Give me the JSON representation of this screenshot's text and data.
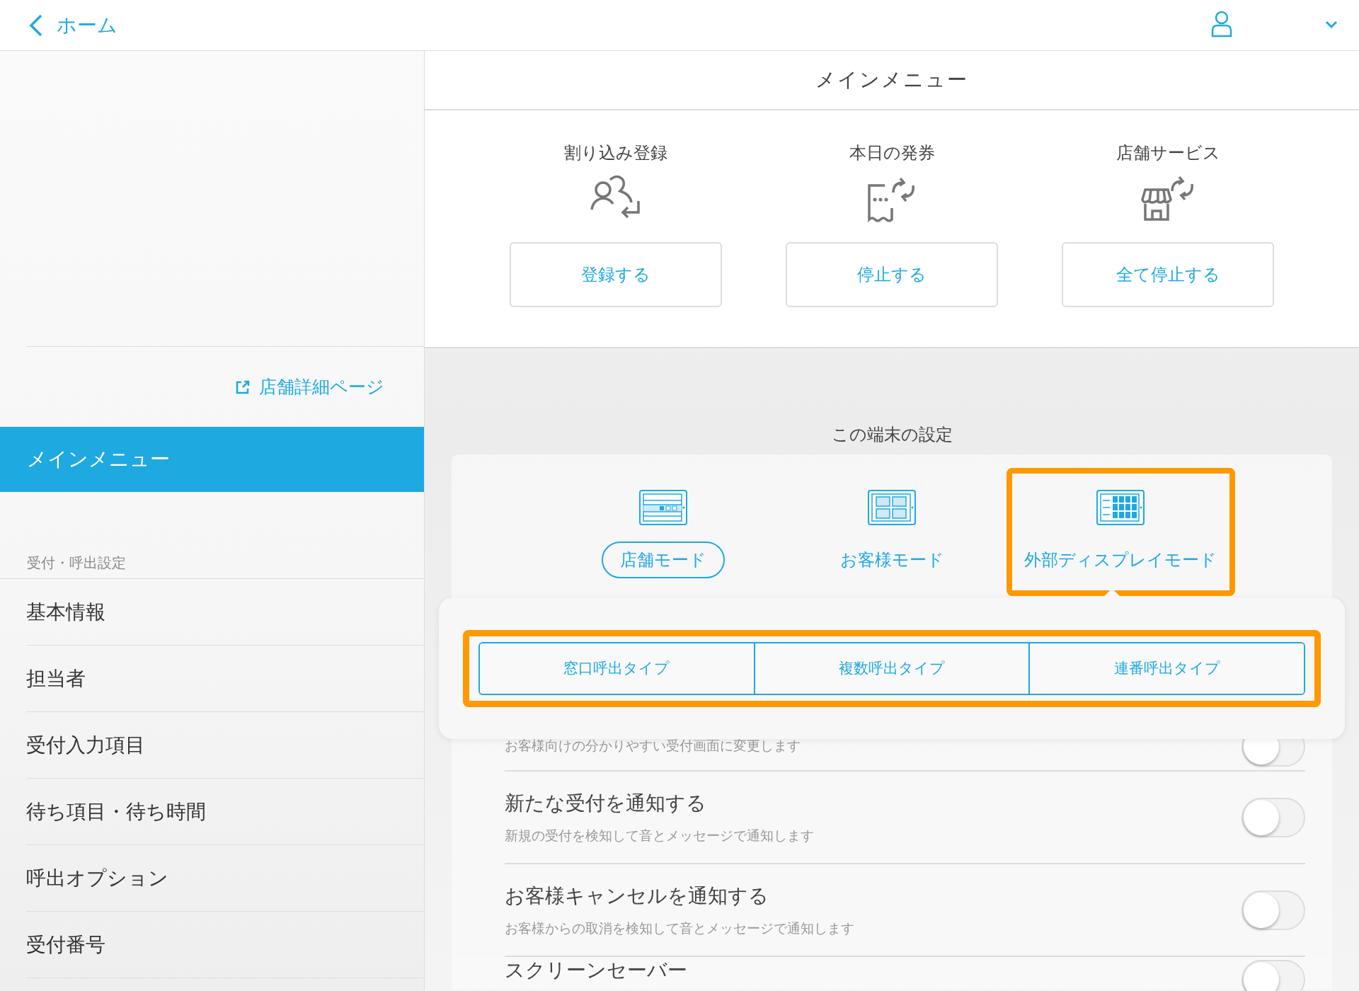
{
  "header": {
    "back_label": "ホーム"
  },
  "sidebar": {
    "link": "店舗詳細ページ",
    "items": [
      {
        "label": "メインメニュー",
        "selected": true
      }
    ],
    "section": {
      "title": "受付・呼出設定",
      "items": [
        {
          "label": "基本情報",
          "selected": false
        },
        {
          "label": "担当者",
          "selected": false
        },
        {
          "label": "受付入力項目",
          "selected": false
        },
        {
          "label": "待ち項目・待ち時間",
          "selected": false
        },
        {
          "label": "呼出オプション",
          "selected": false
        },
        {
          "label": "受付番号",
          "selected": false
        }
      ]
    }
  },
  "main": {
    "title": "メインメニュー",
    "actions": [
      {
        "title": "割り込み登録",
        "button": "登録する"
      },
      {
        "title": "本日の発券",
        "button": "停止する"
      },
      {
        "title": "店舗サービス",
        "button": "全て停止する"
      }
    ],
    "device_settings": {
      "title": "この端末の設定",
      "modes": [
        {
          "label": "店舗モード",
          "selected": true,
          "highlighted": false
        },
        {
          "label": "お客様モード",
          "selected": false,
          "highlighted": false
        },
        {
          "label": "外部ディスプレイモード",
          "selected": false,
          "highlighted": true
        }
      ],
      "call_types": {
        "highlighted": true,
        "options": [
          {
            "label": "窓口呼出タイプ"
          },
          {
            "label": "複数呼出タイプ"
          },
          {
            "label": "連番呼出タイプ"
          }
        ]
      },
      "settings": [
        {
          "description": "お客様向けの分かりやすい受付画面に変更します",
          "on": false
        },
        {
          "title": "新たな受付を通知する",
          "description": "新規の受付を検知して音とメッセージで通知します",
          "on": false
        },
        {
          "title": "お客様キャンセルを通知する",
          "description": "お客様からの取消を検知して音とメッセージで通知します",
          "on": false
        },
        {
          "title": "スクリーンセーバー",
          "on": false
        }
      ]
    }
  }
}
